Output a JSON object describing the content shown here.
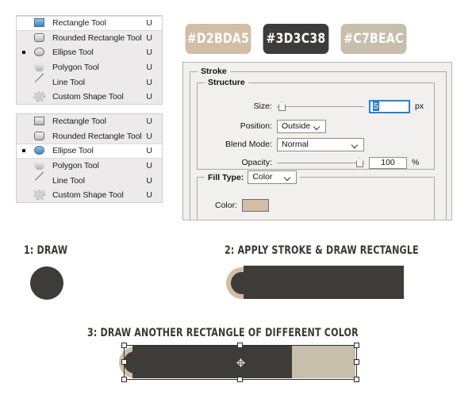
{
  "tool_panels": [
    {
      "name": "shape-tools-flyout-1",
      "items": [
        {
          "label": "Rectangle Tool",
          "shortcut": "U",
          "icon": "rectangle-icon",
          "selected": true
        },
        {
          "label": "Rounded Rectangle Tool",
          "shortcut": "U",
          "icon": "rounded-rectangle-icon",
          "selected": false
        },
        {
          "label": "Ellipse Tool",
          "shortcut": "U",
          "icon": "ellipse-icon",
          "selected": false,
          "bullet": true
        },
        {
          "label": "Polygon Tool",
          "shortcut": "U",
          "icon": "polygon-icon",
          "selected": false
        },
        {
          "label": "Line Tool",
          "shortcut": "U",
          "icon": "line-icon",
          "selected": false
        },
        {
          "label": "Custom Shape Tool",
          "shortcut": "U",
          "icon": "custom-shape-icon",
          "selected": false
        }
      ]
    },
    {
      "name": "shape-tools-flyout-2",
      "items": [
        {
          "label": "Rectangle Tool",
          "shortcut": "U",
          "icon": "rectangle-icon",
          "selected": false
        },
        {
          "label": "Rounded Rectangle Tool",
          "shortcut": "U",
          "icon": "rounded-rectangle-icon",
          "selected": false
        },
        {
          "label": "Ellipse Tool",
          "shortcut": "U",
          "icon": "ellipse-icon",
          "selected": true,
          "bullet": true
        },
        {
          "label": "Polygon Tool",
          "shortcut": "U",
          "icon": "polygon-icon",
          "selected": false
        },
        {
          "label": "Line Tool",
          "shortcut": "U",
          "icon": "line-icon",
          "selected": false
        },
        {
          "label": "Custom Shape Tool",
          "shortcut": "U",
          "icon": "custom-shape-icon",
          "selected": false
        }
      ]
    }
  ],
  "swatches": [
    {
      "label": "#D2BDA5",
      "color": "#D2BDA5"
    },
    {
      "label": "#3D3C38",
      "color": "#3D3C38"
    },
    {
      "label": "#C7BEAC",
      "color": "#C7BEAC"
    }
  ],
  "stroke_dialog": {
    "group_title": "Stroke",
    "structure_title": "Structure",
    "size": {
      "label": "Size:",
      "value": "5",
      "unit": "px",
      "slider_percent": 3
    },
    "position": {
      "label": "Position:",
      "value": "Outside"
    },
    "blend_mode": {
      "label": "Blend Mode:",
      "value": "Normal"
    },
    "opacity": {
      "label": "Opacity:",
      "value": "100",
      "unit": "%",
      "slider_percent": 100
    },
    "fill_type": {
      "label": "Fill Type:",
      "value": "Color"
    },
    "color": {
      "label": "Color:",
      "value": "#D2BDA5"
    }
  },
  "steps": [
    {
      "caption": "1: DRAW"
    },
    {
      "caption": "2: APPLY STROKE & DRAW RECTANGLE"
    },
    {
      "caption": "3: DRAW ANOTHER RECTANGLE OF DIFFERENT COLOR"
    }
  ]
}
